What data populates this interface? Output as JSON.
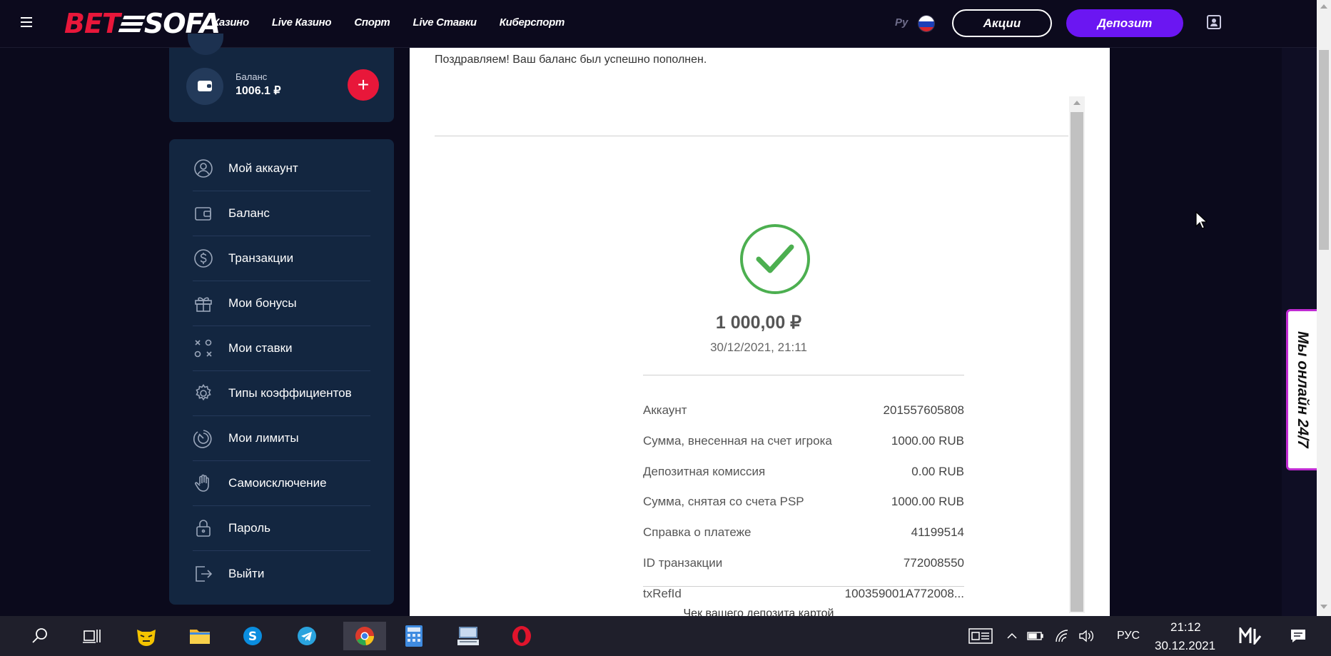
{
  "header": {
    "logo_left": "BET",
    "logo_right": "SOFA",
    "nav": [
      "Казино",
      "Live Казино",
      "Спорт",
      "Live Ставки",
      "Киберспорт"
    ],
    "lang": "Ру",
    "promo_label": "Акции",
    "deposit_label": "Депозит"
  },
  "balance": {
    "label": "Баланс",
    "value": "1006.1 ₽",
    "add_label": "+"
  },
  "menu": [
    {
      "label": "Мой аккаунт",
      "icon": "user-icon"
    },
    {
      "label": "Баланс",
      "icon": "wallet-icon"
    },
    {
      "label": "Транзакции",
      "icon": "dollar-icon"
    },
    {
      "label": "Мои бонусы",
      "icon": "gift-icon"
    },
    {
      "label": "Мои ставки",
      "icon": "tactics-icon"
    },
    {
      "label": "Типы коэффициентов",
      "icon": "gear-icon"
    },
    {
      "label": "Мои лимиты",
      "icon": "limit-icon"
    },
    {
      "label": "Самоисключение",
      "icon": "hand-icon"
    },
    {
      "label": "Пароль",
      "icon": "lock-icon"
    },
    {
      "label": "Выйти",
      "icon": "logout-icon"
    }
  ],
  "receipt": {
    "congrats": "Поздравляем! Ваш баланс был успешно пополнен.",
    "amount": "1 000,00 ₽",
    "datetime": "30/12/2021, 21:11",
    "rows": [
      {
        "label": "Аккаунт",
        "value": "201557605808"
      },
      {
        "label": "Сумма, внесенная на счет игрока",
        "value": "1000.00 RUB"
      },
      {
        "label": "Депозитная комиссия",
        "value": "0.00 RUB"
      },
      {
        "label": "Сумма, снятая со счета PSP",
        "value": "1000.00 RUB"
      },
      {
        "label": "Справка о платеже",
        "value": "41199514"
      },
      {
        "label": "ID транзакции",
        "value": "772008550"
      },
      {
        "label": "txRefId",
        "value": "100359001A772008..."
      }
    ],
    "footer_text": "Чек вашего депозита картой"
  },
  "chat": {
    "label": "Мы онлайн 24/7"
  },
  "taskbar": {
    "lang": "РУС",
    "time": "21:12",
    "date": "30.12.2021"
  },
  "colors": {
    "accent_red": "#e8173a",
    "deposit_purple": "#6b16f2",
    "success_green": "#4caf50",
    "panel_navy": "#132640",
    "chat_magenta": "#c02bd3"
  }
}
